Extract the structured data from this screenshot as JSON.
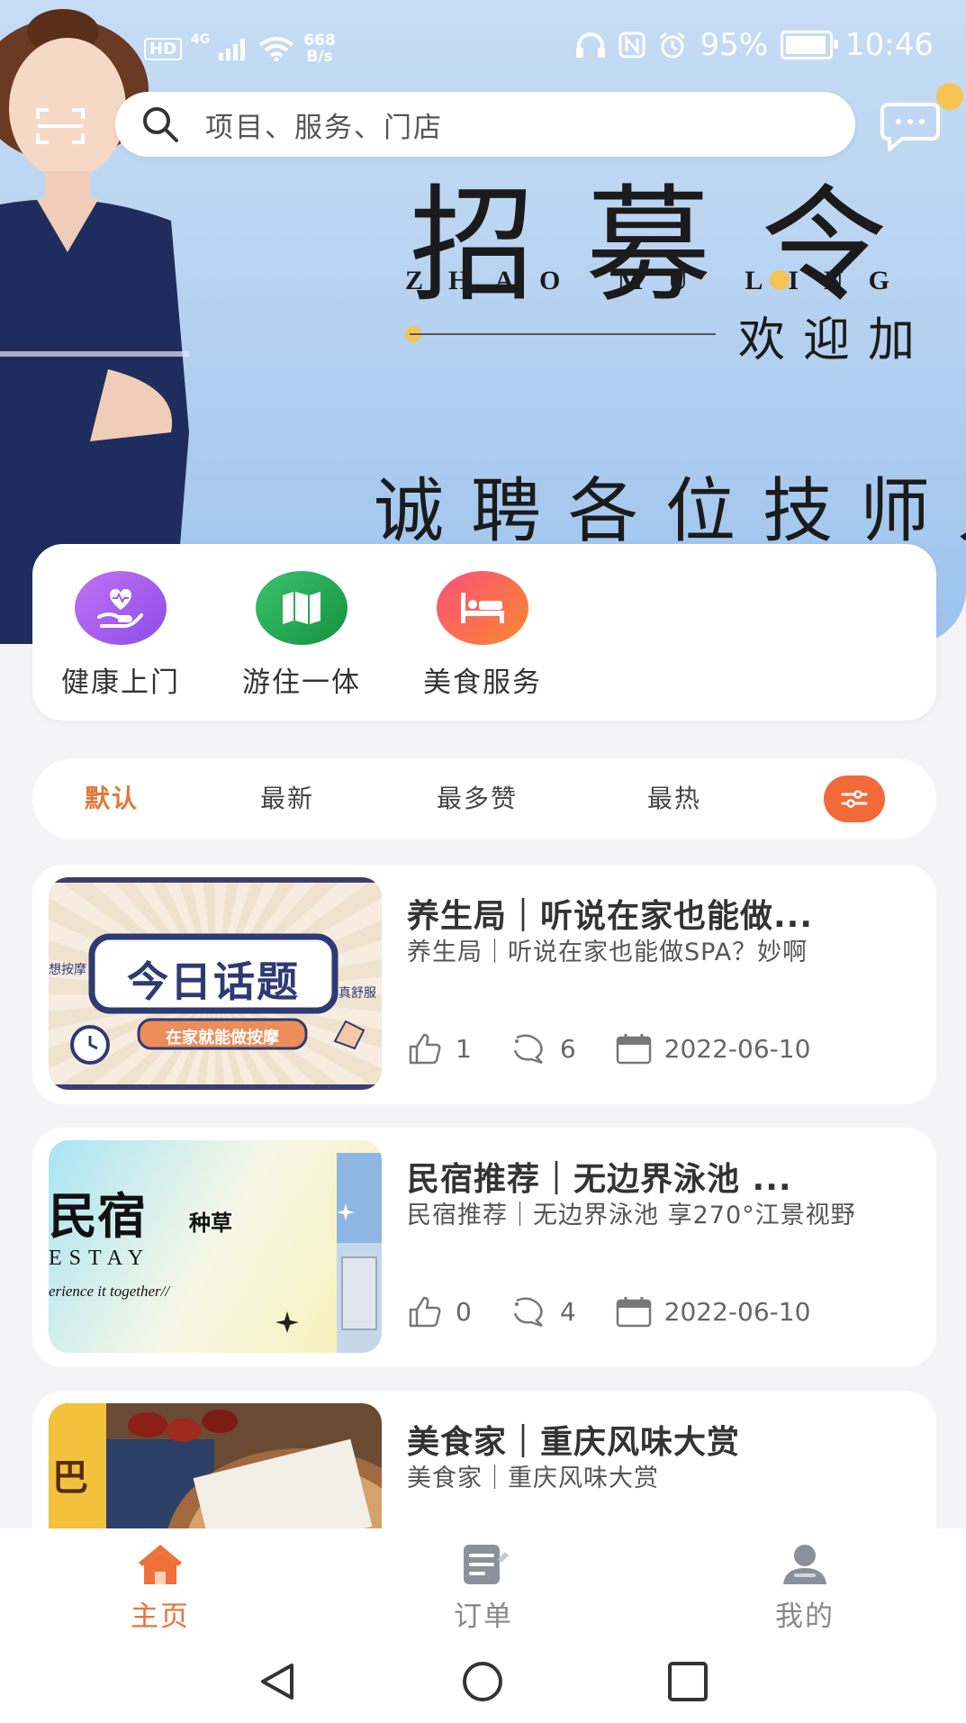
{
  "status_bar": {
    "hd": "HD",
    "network": "4G",
    "speed_value": "668",
    "speed_unit": "B/s",
    "battery": "95%",
    "battery_level": 0.95,
    "time": "10:46"
  },
  "search": {
    "placeholder": "项目、服务、门店"
  },
  "banner": {
    "title": "招募令",
    "pinyin": "ZHAO MU LING",
    "welcome": "欢迎加",
    "subtitle": "诚聘各位技师入"
  },
  "categories": [
    {
      "label": "健康上门",
      "icon": "heart-hand-icon",
      "color": "#a45ef0"
    },
    {
      "label": "游住一体",
      "icon": "map-icon",
      "color": "#21a955"
    },
    {
      "label": "美食服务",
      "icon": "bed-icon",
      "color": "#f6614a"
    }
  ],
  "sort_tabs": [
    {
      "label": "默认",
      "active": true
    },
    {
      "label": "最新",
      "active": false
    },
    {
      "label": "最多赞",
      "active": false
    },
    {
      "label": "最热",
      "active": false
    }
  ],
  "articles": [
    {
      "title": "养生局｜听说在家也能做...",
      "desc": "养生局｜听说在家也能做SPA？妙啊",
      "likes": "1",
      "comments": "6",
      "date": "2022-06-10",
      "thumb": {
        "heading": "今日话题",
        "side_left": "想按摩",
        "side_right": "真舒服",
        "banner": "在家就能做按摩"
      }
    },
    {
      "title": "民宿推荐｜无边界泳池 ...",
      "desc": "民宿推荐｜无边界泳池 享270°江景视野",
      "likes": "0",
      "comments": "4",
      "date": "2022-06-10",
      "thumb": {
        "heading": "民宿",
        "tag": "种草",
        "sub": "ESTAY",
        "caption": "erience it together//"
      }
    },
    {
      "title": "美食家｜重庆风味大赏",
      "desc": "美食家｜重庆风味大赏",
      "thumb": {
        "side": "巴"
      }
    }
  ],
  "bottom_nav": [
    {
      "label": "主页",
      "icon": "home-icon",
      "active": true
    },
    {
      "label": "订单",
      "icon": "orders-icon",
      "active": false
    },
    {
      "label": "我的",
      "icon": "profile-icon",
      "active": false
    }
  ],
  "colors": {
    "accent": "#f0703a",
    "active_tab": "#e07a39",
    "background": "#f4f4f6"
  }
}
